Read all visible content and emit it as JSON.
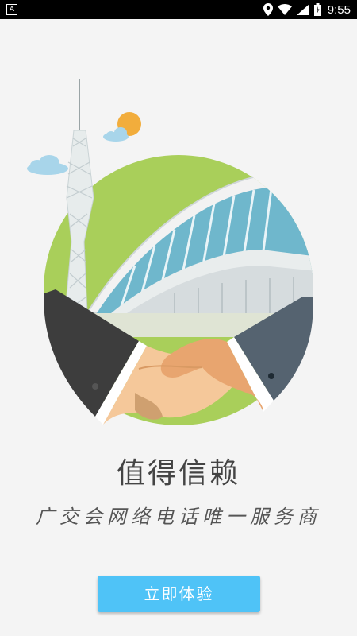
{
  "status_bar": {
    "left_icon_letter": "A",
    "time": "9:55"
  },
  "main": {
    "title": "值得信赖",
    "subtitle": "广交会网络电话唯一服务商",
    "button_label": "立即体验"
  },
  "colors": {
    "accent": "#4fc3f7",
    "circle_green": "#a9cf5a",
    "sun": "#f2ad3c",
    "sleeve_dark": "#3d3d3d",
    "sleeve_slate": "#556370",
    "skin": "#f5c89a"
  }
}
